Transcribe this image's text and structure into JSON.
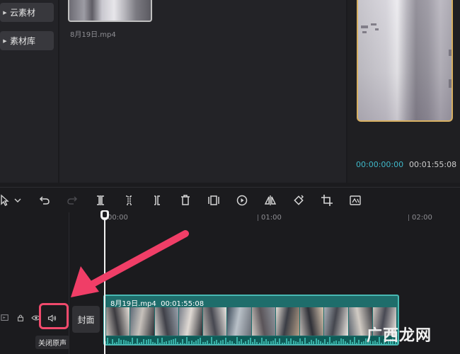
{
  "sidebar": {
    "items": [
      {
        "label": "云素材"
      },
      {
        "label": "素材库"
      }
    ]
  },
  "media": {
    "items": [
      {
        "name": "8月19日.mp4"
      }
    ]
  },
  "player": {
    "current_time": "00:00:00:00",
    "total_time": "00:01:55:08"
  },
  "toolbar": {
    "tools": [
      "select-pointer-icon",
      "chevron-down-icon",
      "undo-icon",
      "redo-icon",
      "split-icon",
      "split-left-icon",
      "split-right-icon",
      "delete-icon",
      "freeze-frame-icon",
      "play-reverse-icon",
      "mirror-icon",
      "rotate-icon",
      "crop-icon",
      "auto-reframe-icon"
    ]
  },
  "timeline": {
    "ruler": [
      "00:00",
      "01:00",
      "02:00"
    ],
    "track": {
      "cover_label": "封面",
      "tooltip": "关闭原声"
    },
    "clip": {
      "name": "8月19日.mp4",
      "duration": "00:01:55:08"
    }
  },
  "watermark": "广西龙网",
  "colors": {
    "accent_time": "#3fb8c9",
    "clip_bg": "#1e6d6b",
    "clip_border": "#48b9b3",
    "highlight": "#f04a6c",
    "preview_border": "#d8b062"
  }
}
